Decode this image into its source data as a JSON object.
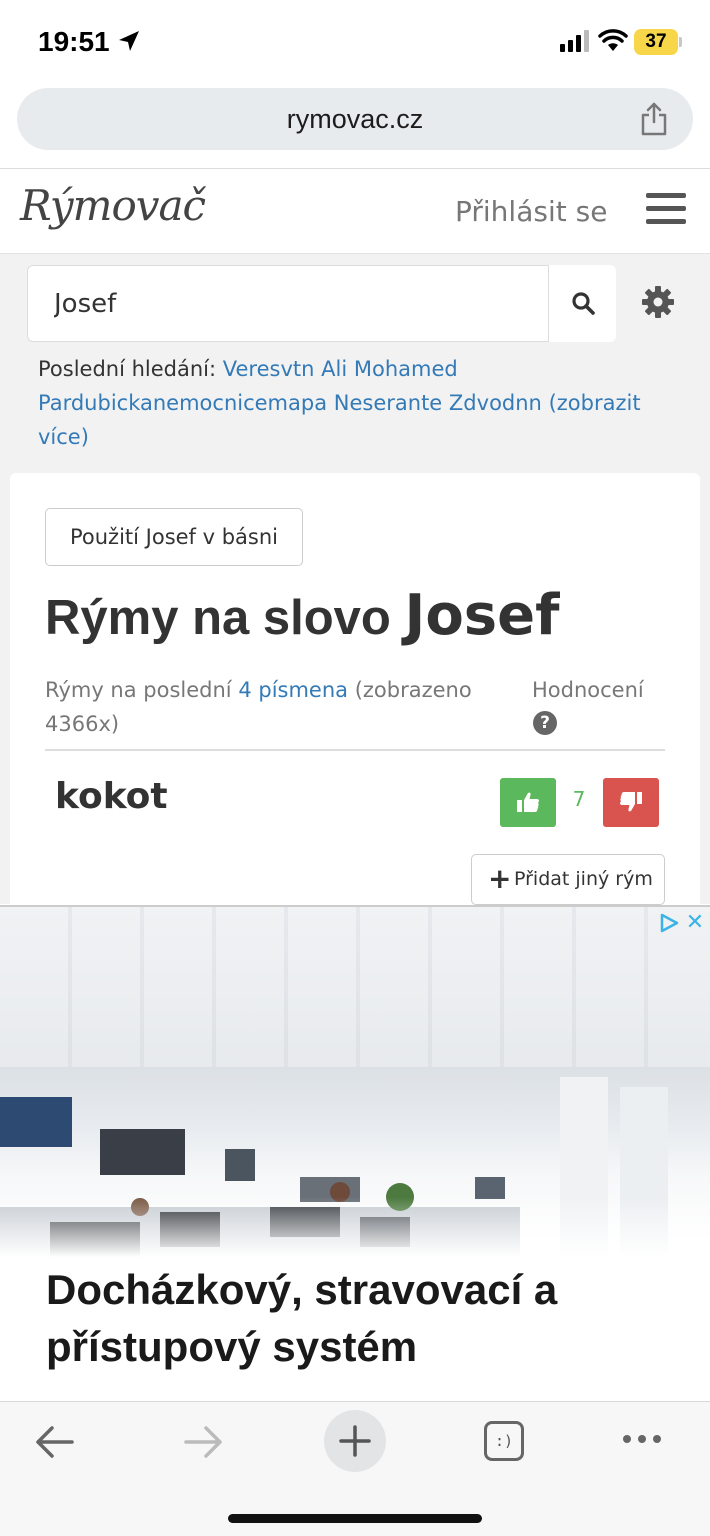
{
  "status_bar": {
    "time": "19:51",
    "battery": "37",
    "icons": [
      "location-arrow-icon",
      "signal-icon",
      "wifi-icon",
      "battery-icon"
    ]
  },
  "browser": {
    "url": "rymovac.cz",
    "toolbar_icons": [
      "back-arrow-icon",
      "forward-arrow-icon",
      "plus-icon",
      "tabs-icon",
      "more-icon"
    ],
    "tabs_glyph": ":)"
  },
  "header": {
    "logo": "Rýmovač",
    "login": "Přihlásit se"
  },
  "search": {
    "value": "Josef",
    "recent_label": "Poslední hledání:",
    "recent_items": [
      "Veresvtn",
      "Ali Mohamed",
      "Pardubickanemocnicemapa",
      "Neserante",
      "Zdvodnn"
    ],
    "show_more": "(zobrazit více)"
  },
  "card": {
    "usage_button": "Použití Josef v básni",
    "title_prefix": "Rýmy na slovo",
    "title_word": "Josef",
    "meta_prefix": "Rýmy na poslední",
    "meta_link": "4 písmena",
    "meta_suffix": "(zobrazeno 4366x)",
    "rating_header": "Hodnocení",
    "help_glyph": "?"
  },
  "rhymes": [
    {
      "word": "kokot",
      "score": "7"
    }
  ],
  "add_button": "Přidat jiný rým",
  "ad": {
    "headline": "Docházkový, stravovací a přístupový systém",
    "close": "✕"
  },
  "colors": {
    "link": "#337ab7",
    "upvote": "#5cb85c",
    "downvote": "#d9534f",
    "battery": "#f7d64a"
  }
}
